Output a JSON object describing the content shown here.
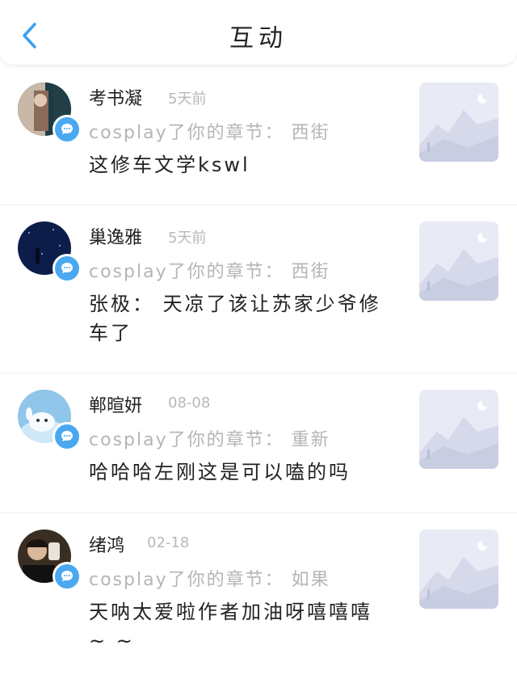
{
  "header": {
    "title": "互动",
    "back_icon": "chevron-left-icon",
    "accent": "#3aa0f0"
  },
  "items": [
    {
      "name": "考书凝",
      "time": "5天前",
      "sub": "cosplay了你的章节： 西街",
      "content": "这修车文学kswl",
      "avatar": "avatar-photo-1",
      "badge_icon": "comment-icon"
    },
    {
      "name": "巢逸雅",
      "time": "5天前",
      "sub": "cosplay了你的章节： 西街",
      "content": "张极： 天凉了该让苏家少爷修车了",
      "avatar": "avatar-photo-2",
      "badge_icon": "comment-icon"
    },
    {
      "name": "郸暄妍",
      "time": "08-08",
      "sub": "cosplay了你的章节： 重新",
      "content": "哈哈哈左刚这是可以嗑的吗",
      "avatar": "avatar-photo-3",
      "badge_icon": "comment-icon"
    },
    {
      "name": "绪鸿",
      "time": "02-18",
      "sub": "cosplay了你的章节： 如果",
      "content": "天呐太爱啦作者加油呀嘻嘻嘻 ~ ~",
      "avatar": "avatar-photo-4",
      "badge_icon": "comment-icon"
    }
  ],
  "colors": {
    "badge": "#4aa8f0",
    "thumb_bg": "#e9ecf6",
    "muted": "#b5b5b5"
  }
}
